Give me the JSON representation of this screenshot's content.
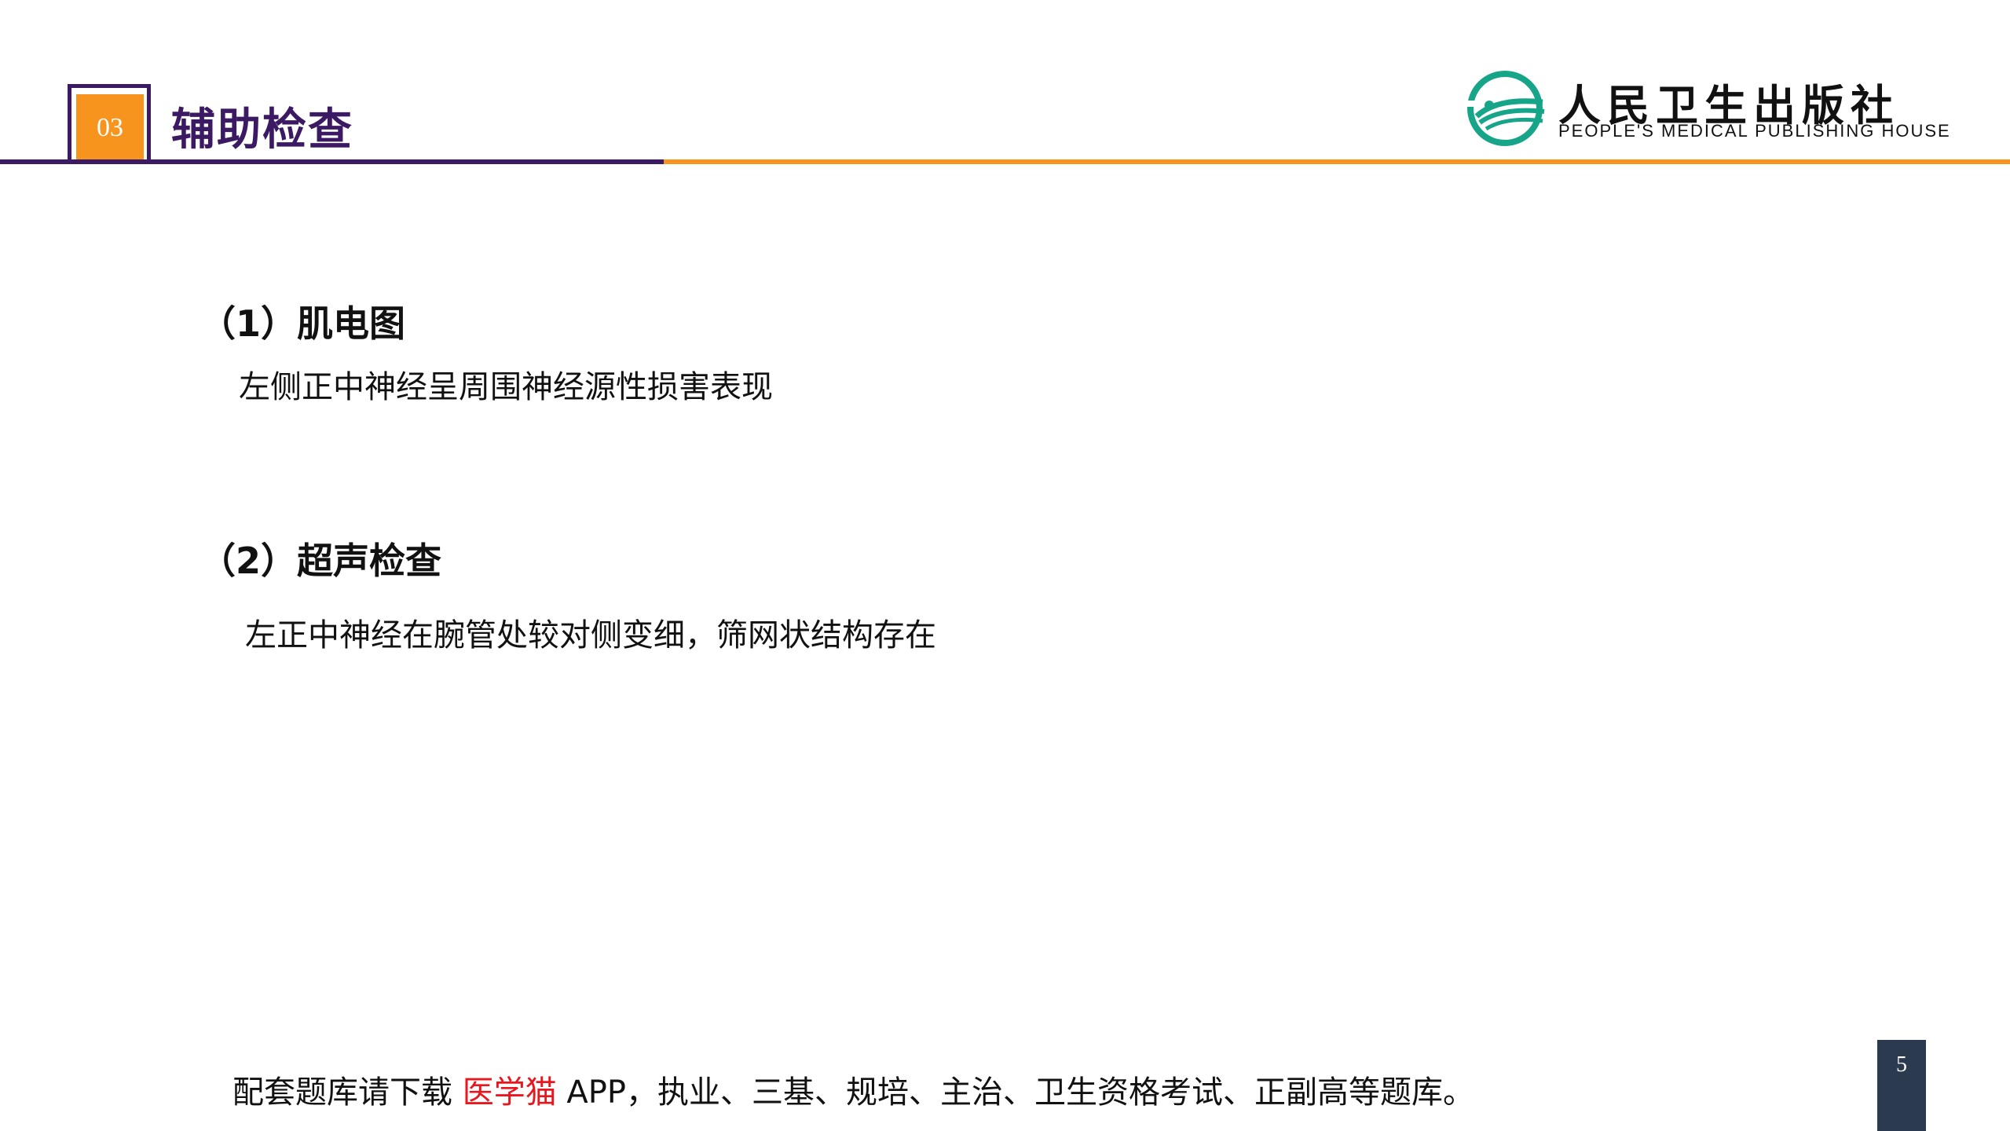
{
  "header": {
    "section_number": "03",
    "title": "辅助检查"
  },
  "logo": {
    "name_cn": "人民卫生出版社",
    "name_en": "PEOPLE'S MEDICAL PUBLISHING HOUSE"
  },
  "sections": [
    {
      "heading": "（1）肌电图",
      "body": "左侧正中神经呈周围神经源性损害表现"
    },
    {
      "heading": "（2）超声检查",
      "body": "左正中神经在腕管处较对侧变细，筛网状结构存在"
    }
  ],
  "footer": {
    "prefix": "配套题库请下载 ",
    "highlight": "医学猫",
    "suffix": " APP，执业、三基、规培、主治、卫生资格考试、正副高等题库。"
  },
  "page_number": "5",
  "colors": {
    "purple": "#3c1a63",
    "orange": "#f7941d",
    "logo_teal": "#17a589",
    "highlight_red": "#e8171f",
    "page_box": "#2b3a4e"
  }
}
